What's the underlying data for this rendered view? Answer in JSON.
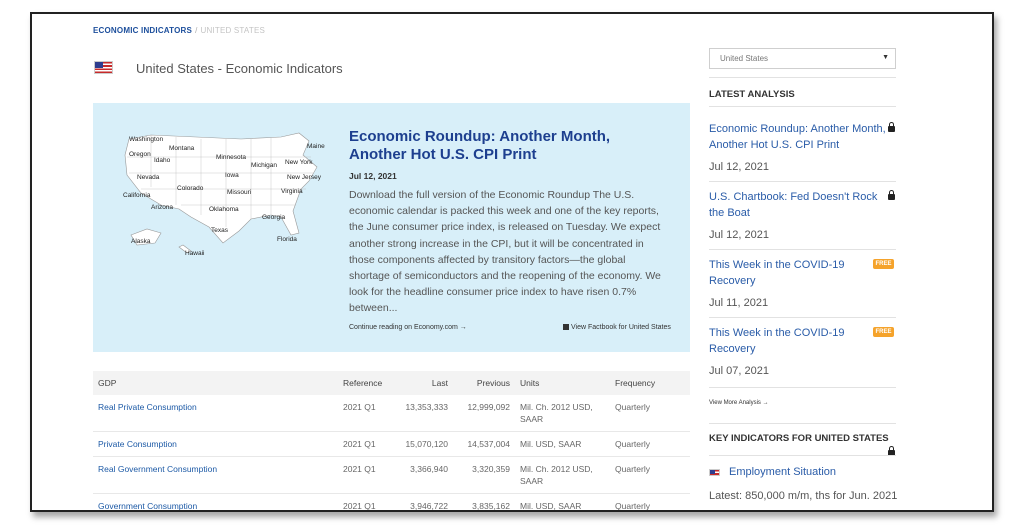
{
  "breadcrumb": {
    "parent": "ECONOMIC INDICATORS",
    "separator": "/",
    "current": "UNITED STATES"
  },
  "page": {
    "title": "United States - Economic Indicators"
  },
  "feature": {
    "title": "Economic Roundup: Another Month, Another Hot U.S. CPI Print",
    "date": "Jul 12, 2021",
    "body": "Download the full version of the Economic Roundup The U.S. economic calendar is packed this week and one of the key reports, the June consumer price index, is released on Tuesday. We expect another strong increase in the CPI, but it will be concentrated in those components affected by transitory factors—the global shortage of semiconductors and the reopening of the economy. We look for the headline consumer price index to have risen 0.7% between...",
    "continue_label": "Continue reading on Economy.com →",
    "factbook_label": "View Factbook for United States",
    "map_labels": [
      "Washington",
      "Oregon",
      "Idaho",
      "Montana",
      "Nevada",
      "California",
      "Arizona",
      "Colorado",
      "Minnesota",
      "Iowa",
      "Missouri",
      "Oklahoma",
      "Texas",
      "Michigan",
      "New York",
      "Maine",
      "New Jersey",
      "Virginia",
      "Georgia",
      "Florida",
      "Alaska",
      "Hawaii"
    ]
  },
  "table": {
    "headers": [
      "GDP",
      "Reference",
      "Last",
      "Previous",
      "Units",
      "Frequency"
    ],
    "rows": [
      {
        "name": "Real Private Consumption",
        "reference": "2021 Q1",
        "last": "13,353,333",
        "previous": "12,999,092",
        "units": "Mil. Ch. 2012 USD, SAAR",
        "frequency": "Quarterly"
      },
      {
        "name": "Private Consumption",
        "reference": "2021 Q1",
        "last": "15,070,120",
        "previous": "14,537,004",
        "units": "Mil. USD, SAAR",
        "frequency": "Quarterly"
      },
      {
        "name": "Real Government Consumption",
        "reference": "2021 Q1",
        "last": "3,366,940",
        "previous": "3,320,359",
        "units": "Mil. Ch. 2012 USD, SAAR",
        "frequency": "Quarterly"
      },
      {
        "name": "Government Consumption",
        "reference": "2021 Q1",
        "last": "3,946,722",
        "previous": "3,835,162",
        "units": "Mil. USD, SAAR",
        "frequency": "Quarterly"
      }
    ]
  },
  "sidebar": {
    "country_select": "United States",
    "latest_heading": "LATEST ANALYSIS",
    "free_badge": "FREE",
    "analysis": [
      {
        "title": "Economic Roundup: Another Month, Another Hot U.S. CPI Print",
        "date": "Jul 12, 2021",
        "access": "locked"
      },
      {
        "title": "U.S. Chartbook: Fed Doesn't Rock the Boat",
        "date": "Jul 12, 2021",
        "access": "locked"
      },
      {
        "title": "This Week in the COVID-19 Recovery",
        "date": "Jul 11, 2021",
        "access": "free"
      },
      {
        "title": "This Week in the COVID-19 Recovery",
        "date": "Jul 07, 2021",
        "access": "free"
      }
    ],
    "view_more": "View More Analysis →",
    "key_heading": "KEY INDICATORS FOR UNITED STATES",
    "key_indicator": {
      "label": "Employment Situation",
      "latest": "Latest: 850,000 m/m, ths for Jun. 2021"
    }
  },
  "colors": {
    "link": "#2a5ca8",
    "panel_bg": "#d8eff9",
    "free_badge": "#f5a32b",
    "headline": "#1d3f8f"
  }
}
